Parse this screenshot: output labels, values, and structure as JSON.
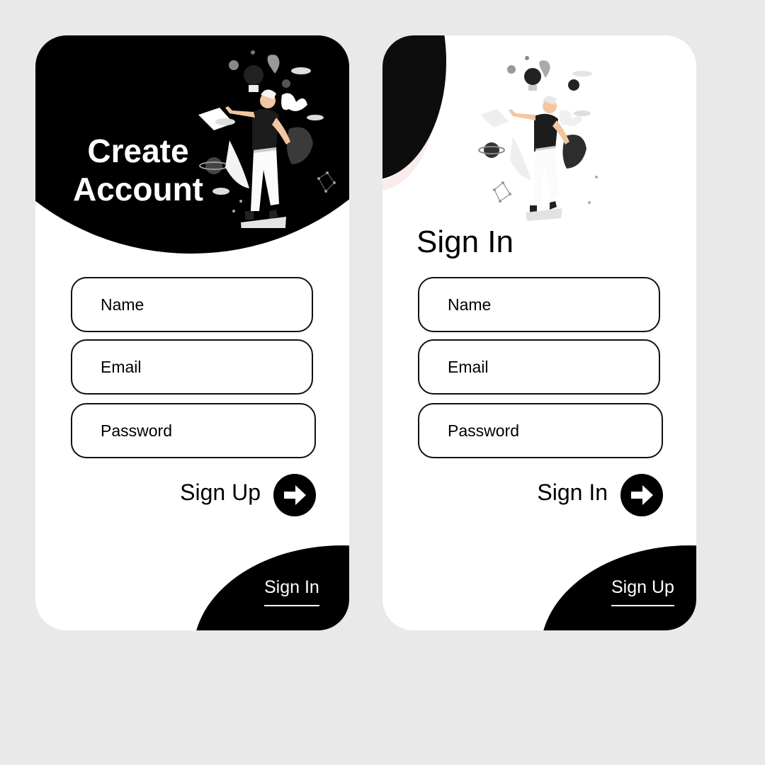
{
  "create_account": {
    "title": "Create Account",
    "fields": [
      {
        "placeholder": "Name"
      },
      {
        "placeholder": "Email"
      },
      {
        "placeholder": "Password"
      }
    ],
    "action_label": "Sign Up",
    "corner_link": "Sign In"
  },
  "sign_in": {
    "title": "Sign In",
    "fields": [
      {
        "placeholder": "Name"
      },
      {
        "placeholder": "Email"
      },
      {
        "placeholder": "Password"
      }
    ],
    "action_label": "Sign In",
    "corner_link": "Sign Up"
  },
  "colors": {
    "background": "#e9e9e9",
    "card": "#ffffff",
    "accent": "#000000"
  },
  "icons": {
    "action_arrow": "arrow-right-icon",
    "illustration": "floating-person-illustration"
  }
}
